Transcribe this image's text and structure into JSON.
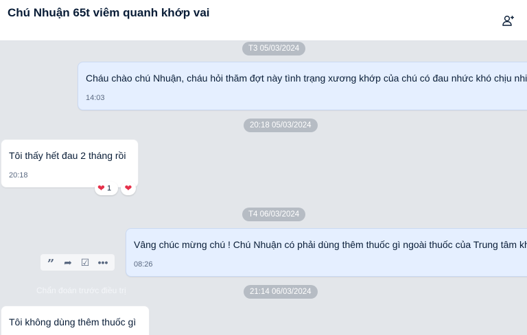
{
  "header": {
    "title": "Chú Nhuận 65t viêm quanh khớp vai"
  },
  "messages": [
    {
      "date": "T3 05/03/2024",
      "text": "Cháu chào chú Nhuận, cháu hỏi thăm đợt này tình trạng xương khớp của chú có đau nhức khó chịu nhiều không ạ?",
      "time": "14:03"
    },
    {
      "date": "20:18 05/03/2024",
      "text": "Tôi thấy hết đau 2 tháng rồi",
      "time": "20:18",
      "reaction_count": "1"
    },
    {
      "date": "T4 06/03/2024",
      "text": "Vâng chúc mừng chú ! Chú Nhuận có phải dùng thêm thuốc gì ngoài thuốc của Trung tâm không ạ?",
      "time": "08:26"
    },
    {
      "date": "21:14 06/03/2024",
      "text": "Tôi không dùng thêm thuốc gì"
    }
  ],
  "hover_label": "Chẩn đoán trước điều trị",
  "icons": {
    "add_member": "add-member-icon",
    "heart": "heart-icon",
    "quote": "quote-icon",
    "forward": "forward-icon",
    "task": "task-icon",
    "more": "more-icon"
  },
  "colors": {
    "background": "#e3e6ea",
    "outgoing_bubble": "#e5efff",
    "incoming_bubble": "#ffffff",
    "reaction_heart": "#e5304a"
  }
}
